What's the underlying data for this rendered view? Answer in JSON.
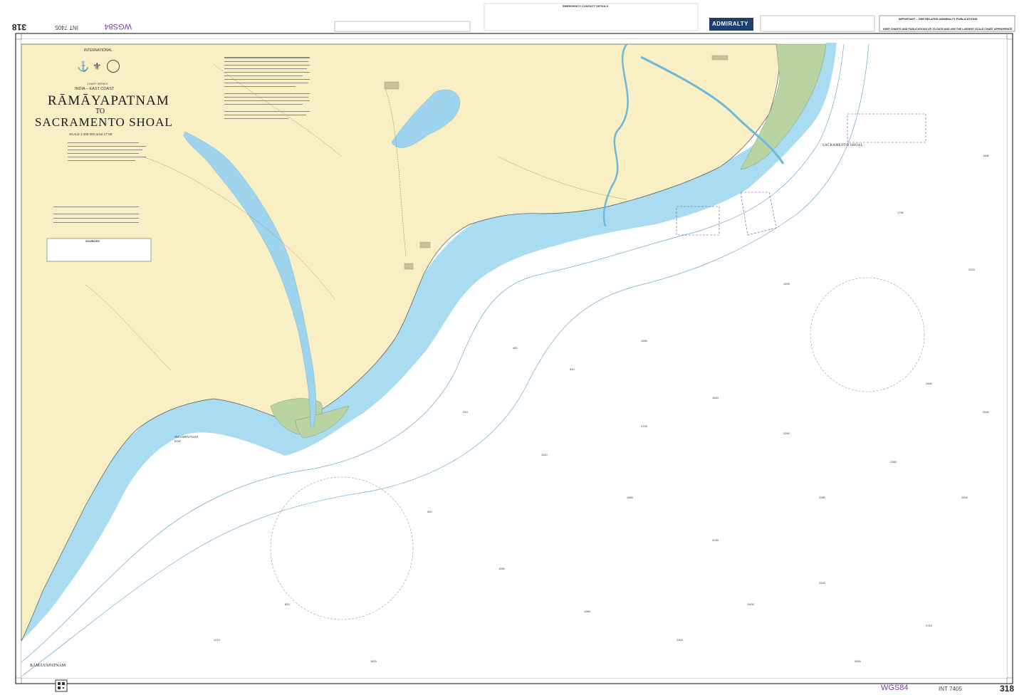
{
  "header": {
    "chart_number": "318",
    "chart_number_rotated": "318",
    "int_number_rotated": "INT 7405",
    "datum_rotated": "WGS84",
    "publisher": "ADMIRALTY",
    "notice_top": "IMPORTANT – SEE RELATED ADMIRALTY PUBLICATIONS",
    "notice_keep": "KEEP CHARTS AND PUBLICATIONS UP-TO-DATE AND USE THE LARGEST SCALE CHART APPROPRIATE",
    "contact_title": "EMERGENCY CONTACT DETAILS"
  },
  "footer": {
    "datum": "WGS84",
    "int_number": "INT 7405",
    "chart_number": "318"
  },
  "title_block": {
    "international": "INTERNATIONAL",
    "series": "CHART SERIES",
    "region": "INDIA – EAST COAST",
    "title_line1": "RĀMĀYAPATNAM",
    "title_to": "TO",
    "title_line2": "SACRAMENTO SHOAL",
    "scale": "SCALE 1:400 000 at lat 17°00'"
  },
  "labels": {
    "ramayapatnam_corner": "RĀMĀYAPATNAM",
    "sacramento_shoal": "SACRAMENTO SHOAL",
    "nizampatnam_bay": "NIZAMPATNAM BAY",
    "sources": "SOURCES"
  },
  "colors": {
    "land": "#f8efc4",
    "shallow_water": "#a9dcf0",
    "deep_water": "#ffffff",
    "intertidal": "#b9d3a3",
    "river": "#9ed4ee",
    "purple": "#7a3fa0",
    "frame": "#333333"
  }
}
